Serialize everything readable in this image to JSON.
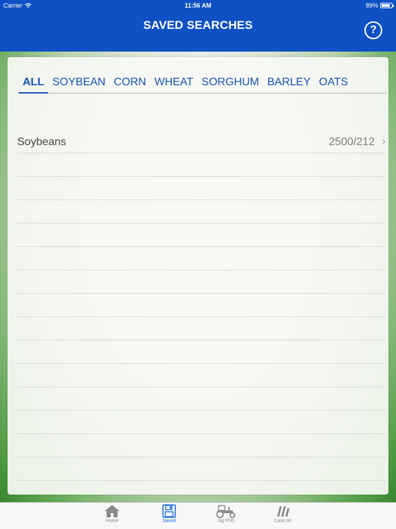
{
  "status_bar": {
    "carrier": "Carrier",
    "time": "11:56 AM",
    "battery": "89%",
    "battery_level": 0.89
  },
  "header": {
    "title": "SAVED SEARCHES",
    "help_label": "?"
  },
  "tabs": [
    {
      "label": "ALL",
      "active": true
    },
    {
      "label": "SOYBEAN",
      "active": false
    },
    {
      "label": "CORN",
      "active": false
    },
    {
      "label": "WHEAT",
      "active": false
    },
    {
      "label": "SORGHUM",
      "active": false
    },
    {
      "label": "BARLEY",
      "active": false
    },
    {
      "label": "OATS",
      "active": false
    }
  ],
  "saved_searches": [
    {
      "name": "Soybeans",
      "value": "2500/212"
    }
  ],
  "bottom_tabs": [
    {
      "label": "Home",
      "icon": "home-icon",
      "active": false
    },
    {
      "label": "Saved",
      "icon": "save-icon",
      "active": true
    },
    {
      "label": "Ag PhD",
      "icon": "tractor-icon",
      "active": false
    },
    {
      "label": "Case IH",
      "icon": "case-ih-icon",
      "active": false
    }
  ],
  "colors": {
    "brand": "#0f51c4",
    "tab_text": "#1553b9",
    "active_tab_icon": "#1f6fe0"
  }
}
